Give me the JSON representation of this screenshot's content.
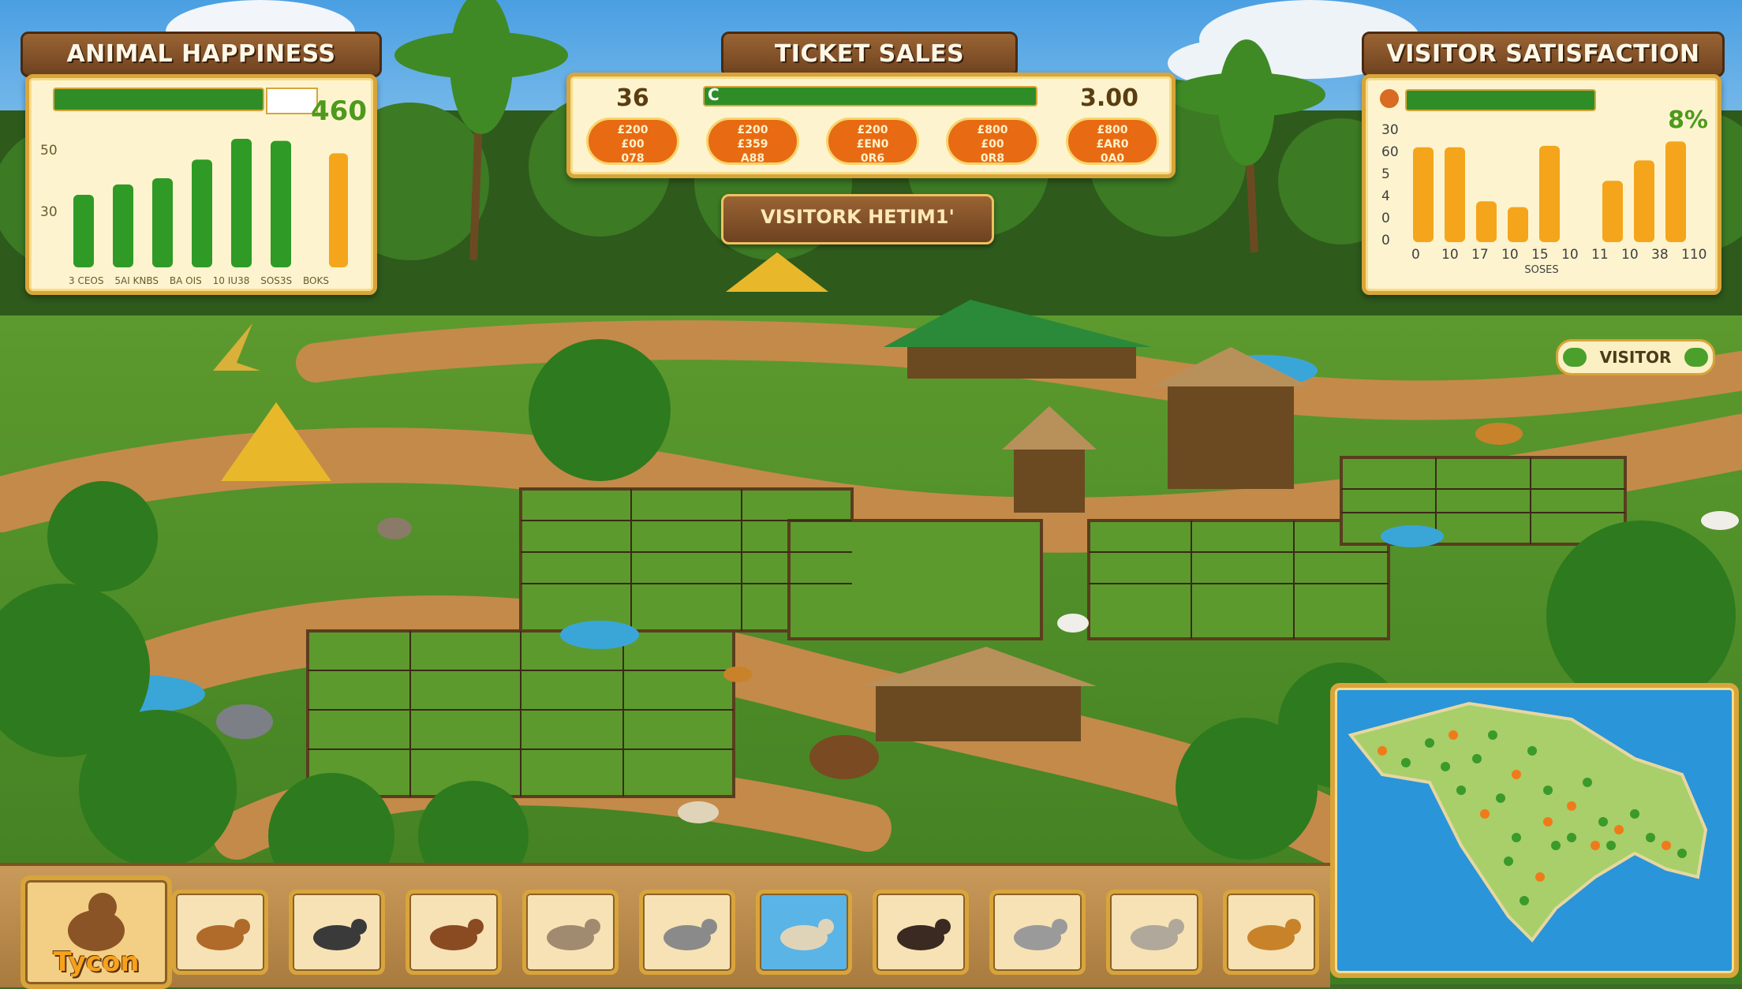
{
  "hud": {
    "animal_happiness": {
      "title": "ANIMAL HAPPINESS",
      "value": "460",
      "y_ticks": [
        "50",
        "30"
      ],
      "x_labels": [
        "3 CEOS",
        "5AI KNBS",
        "BA OIS",
        "10 IU38",
        "SOS3S",
        "BOKS"
      ]
    },
    "ticket_sales": {
      "title": "TICKET SALES",
      "left_value": "36",
      "right_value": "3.00",
      "bar_label": "C",
      "pills": [
        {
          "l1": "£200",
          "l2": "£00",
          "l3": "078"
        },
        {
          "l1": "£200",
          "l2": "£359",
          "l3": "A88"
        },
        {
          "l1": "£200",
          "l2": "£EN0",
          "l3": "0R6"
        },
        {
          "l1": "£800",
          "l2": "£00",
          "l3": "0R8"
        },
        {
          "l1": "£800",
          "l2": "£AR0",
          "l3": "0A0"
        }
      ]
    },
    "visitor_history_button": "VISITORK HETIM1'",
    "visitor_satisfaction": {
      "title": "VISITOR SATISFACTION",
      "value": "8%",
      "y_ticks": [
        "30",
        "60",
        "5",
        "4",
        "0",
        "0"
      ],
      "x_ticks": [
        "0",
        "10",
        "17",
        "10",
        "15",
        "10",
        "11",
        "10",
        "38",
        "110"
      ],
      "x_label": "SOSES"
    },
    "visitor_button": "VISITOR"
  },
  "chart_data": [
    {
      "type": "bar",
      "title": "ANIMAL HAPPINESS",
      "series": [
        {
          "values": [
            35,
            40,
            43,
            52,
            62,
            61
          ],
          "color": "#2f9a25"
        },
        {
          "values": [
            55
          ],
          "color": "#f4a51b"
        }
      ],
      "ylim": [
        0,
        70
      ]
    },
    {
      "type": "bar",
      "title": "VISITOR SATISFACTION",
      "values": [
        65,
        65,
        28,
        24,
        66,
        0,
        42,
        56,
        69
      ],
      "color": "#f4a51b",
      "ylim": [
        0,
        80
      ]
    }
  ],
  "toolbar": {
    "tycon_label": "Tycon",
    "slots": [
      {
        "icon": "deer-icon"
      },
      {
        "icon": "tapir-icon"
      },
      {
        "icon": "capybara-icon"
      },
      {
        "icon": "lemur-icon"
      },
      {
        "icon": "elephant-icon"
      },
      {
        "icon": "llama-icon",
        "selected": true
      },
      {
        "icon": "bear-icon"
      },
      {
        "icon": "panther-icon"
      },
      {
        "icon": "leopard-icon"
      },
      {
        "icon": "fox-icon"
      }
    ]
  },
  "colors": {
    "wood": "#7a4a22",
    "frame_gold": "#d9a43a",
    "panel_cream": "#fdf4cf",
    "bar_green": "#2f8d27",
    "bar_orange": "#f4a51b",
    "pill_orange": "#e86a12",
    "water": "#2a95d8"
  }
}
